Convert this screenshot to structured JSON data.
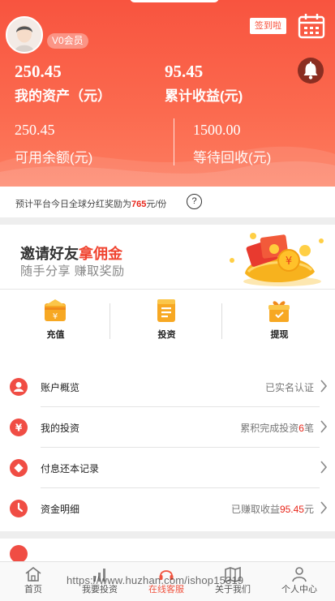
{
  "header": {
    "member_badge": "V0会员",
    "signin_label": "签到啦",
    "total_assets_value": "250.45",
    "total_assets_label": "我的资产（元）",
    "total_income_value": "95.45",
    "total_income_label": "累计收益(元)",
    "available_balance_value": "250.45",
    "available_balance_label": "可用余额(元)",
    "pending_return_value": "1500.00",
    "pending_return_label": "等待回收(元)"
  },
  "notice": {
    "prefix": "预计平台今日全球分红奖励为",
    "amount": "765",
    "suffix": "元/份",
    "help": "?"
  },
  "invite": {
    "title_part1": "邀请好友",
    "title_part2": "拿佣金",
    "subtitle": "随手分享 赚取奖励"
  },
  "quick_actions": [
    {
      "label": "充值",
      "icon": "wallet-icon"
    },
    {
      "label": "投资",
      "icon": "document-icon"
    },
    {
      "label": "提现",
      "icon": "gift-box-icon"
    }
  ],
  "menu": [
    {
      "label": "账户概览",
      "value_pre": "已实名认证",
      "value_hl": "",
      "value_post": "",
      "icon": "user-icon"
    },
    {
      "label": "我的投资",
      "value_pre": "累积完成投资",
      "value_hl": "6",
      "value_post": "笔",
      "icon": "yen-icon"
    },
    {
      "label": "付息还本记录",
      "value_pre": "",
      "value_hl": "",
      "value_post": "",
      "icon": "diamond-icon"
    },
    {
      "label": "资金明细",
      "value_pre": "已赚取收益",
      "value_hl": "95.45",
      "value_post": "元",
      "icon": "clock-icon"
    }
  ],
  "tabbar": [
    {
      "label": "首页",
      "icon": "home-icon",
      "active": false
    },
    {
      "label": "我要投资",
      "icon": "bar-chart-icon",
      "active": false
    },
    {
      "label": "在线客服",
      "icon": "headset-icon",
      "active": true
    },
    {
      "label": "关于我们",
      "icon": "map-icon",
      "active": false
    },
    {
      "label": "个人中心",
      "icon": "person-icon",
      "active": false
    }
  ],
  "watermark": "https://www.huzhan.com/ishop15319",
  "colors": {
    "accent": "#f8543f",
    "highlight": "#e8261a",
    "bell_bg": "#8b2e22",
    "menu_icon": "#f04d44"
  }
}
